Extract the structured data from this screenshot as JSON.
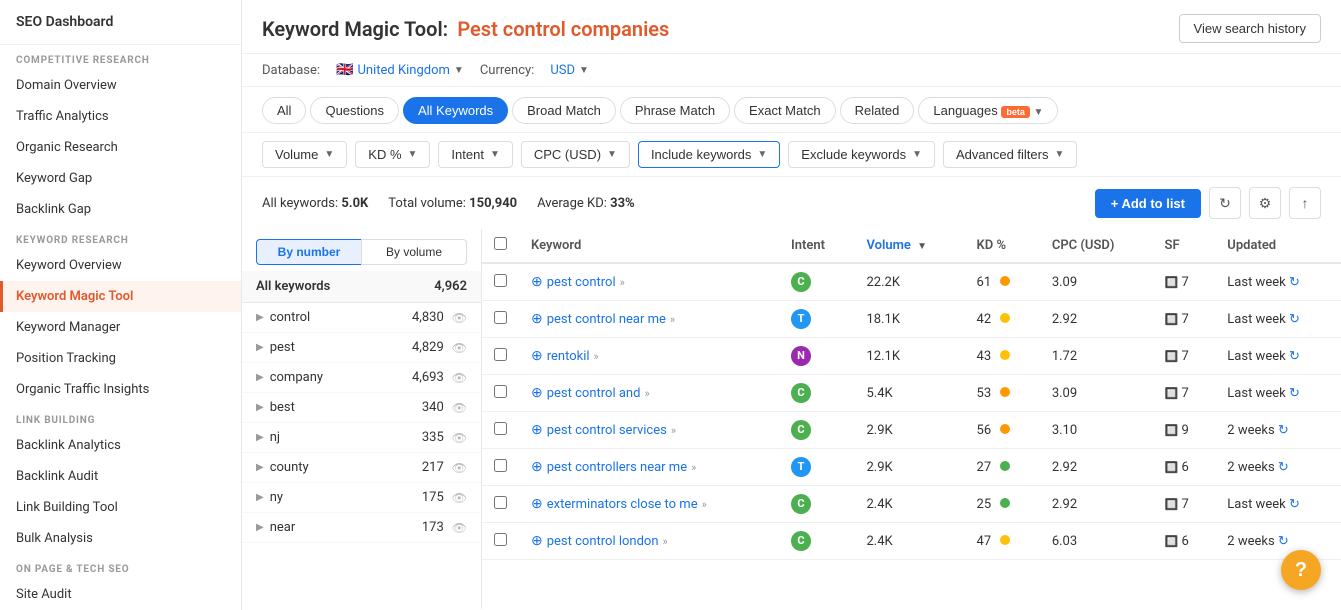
{
  "sidebar": {
    "logo": "SEO Dashboard",
    "sections": [
      {
        "label": "Competitive Research",
        "items": [
          {
            "id": "domain-overview",
            "label": "Domain Overview",
            "active": false
          },
          {
            "id": "traffic-analytics",
            "label": "Traffic Analytics",
            "active": false
          },
          {
            "id": "organic-research",
            "label": "Organic Research",
            "active": false
          },
          {
            "id": "keyword-gap",
            "label": "Keyword Gap",
            "active": false
          },
          {
            "id": "backlink-gap",
            "label": "Backlink Gap",
            "active": false
          }
        ]
      },
      {
        "label": "Keyword Research",
        "items": [
          {
            "id": "keyword-overview",
            "label": "Keyword Overview",
            "active": false
          },
          {
            "id": "keyword-magic-tool",
            "label": "Keyword Magic Tool",
            "active": true
          },
          {
            "id": "keyword-manager",
            "label": "Keyword Manager",
            "active": false
          },
          {
            "id": "position-tracking",
            "label": "Position Tracking",
            "active": false
          },
          {
            "id": "organic-traffic-insights",
            "label": "Organic Traffic Insights",
            "active": false
          }
        ]
      },
      {
        "label": "Link Building",
        "items": [
          {
            "id": "backlink-analytics",
            "label": "Backlink Analytics",
            "active": false
          },
          {
            "id": "backlink-audit",
            "label": "Backlink Audit",
            "active": false
          },
          {
            "id": "link-building-tool",
            "label": "Link Building Tool",
            "active": false
          },
          {
            "id": "bulk-analysis",
            "label": "Bulk Analysis",
            "active": false
          }
        ]
      },
      {
        "label": "On Page & Tech SEO",
        "items": [
          {
            "id": "site-audit",
            "label": "Site Audit",
            "active": false
          }
        ]
      }
    ]
  },
  "header": {
    "title_prefix": "Keyword Magic Tool:",
    "title_query": "Pest control companies",
    "view_history_label": "View search history",
    "database_label": "Database:",
    "database_country": "United Kingdom",
    "currency_label": "Currency:",
    "currency": "USD"
  },
  "tabs": {
    "items": [
      {
        "id": "all",
        "label": "All",
        "active": false
      },
      {
        "id": "questions",
        "label": "Questions",
        "active": false
      },
      {
        "id": "all-keywords",
        "label": "All Keywords",
        "active": true
      },
      {
        "id": "broad-match",
        "label": "Broad Match",
        "active": false
      },
      {
        "id": "phrase-match",
        "label": "Phrase Match",
        "active": false
      },
      {
        "id": "exact-match",
        "label": "Exact Match",
        "active": false
      },
      {
        "id": "related",
        "label": "Related",
        "active": false
      },
      {
        "id": "languages",
        "label": "Languages",
        "active": false,
        "beta": true
      }
    ]
  },
  "filters": {
    "items": [
      {
        "id": "volume",
        "label": "Volume",
        "has_dropdown": true
      },
      {
        "id": "kd",
        "label": "KD %",
        "has_dropdown": true
      },
      {
        "id": "intent",
        "label": "Intent",
        "has_dropdown": true
      },
      {
        "id": "cpc",
        "label": "CPC (USD)",
        "has_dropdown": true
      },
      {
        "id": "include-keywords",
        "label": "Include keywords",
        "has_dropdown": true,
        "highlighted": true
      },
      {
        "id": "exclude-keywords",
        "label": "Exclude keywords",
        "has_dropdown": true
      },
      {
        "id": "advanced-filters",
        "label": "Advanced filters",
        "has_dropdown": true
      }
    ]
  },
  "stats": {
    "all_keywords_label": "All keywords:",
    "all_keywords_value": "5.0K",
    "total_volume_label": "Total volume:",
    "total_volume_value": "150,940",
    "avg_kd_label": "Average KD:",
    "avg_kd_value": "33%",
    "add_to_list_label": "+ Add to list"
  },
  "left_panel": {
    "all_keywords_label": "All keywords",
    "all_keywords_count": "4,962",
    "by_number_label": "By number",
    "by_volume_label": "By volume",
    "items": [
      {
        "name": "control",
        "count": "4,830"
      },
      {
        "name": "pest",
        "count": "4,829"
      },
      {
        "name": "company",
        "count": "4,693"
      },
      {
        "name": "best",
        "count": "340"
      },
      {
        "name": "nj",
        "count": "335"
      },
      {
        "name": "county",
        "count": "217"
      },
      {
        "name": "ny",
        "count": "175"
      },
      {
        "name": "near",
        "count": "173"
      }
    ]
  },
  "table": {
    "columns": [
      {
        "id": "keyword",
        "label": "Keyword"
      },
      {
        "id": "intent",
        "label": "Intent"
      },
      {
        "id": "volume",
        "label": "Volume",
        "sorted": true
      },
      {
        "id": "kd",
        "label": "KD %"
      },
      {
        "id": "cpc",
        "label": "CPC (USD)"
      },
      {
        "id": "sf",
        "label": "SF"
      },
      {
        "id": "updated",
        "label": "Updated"
      }
    ],
    "rows": [
      {
        "keyword": "pest control",
        "intent": "C",
        "intent_type": "c",
        "volume": "22.2K",
        "kd": 61,
        "kd_dot": "orange",
        "cpc": "3.09",
        "sf": "7",
        "updated": "Last week"
      },
      {
        "keyword": "pest control near me",
        "intent": "T",
        "intent_type": "t",
        "volume": "18.1K",
        "kd": 42,
        "kd_dot": "yellow",
        "cpc": "2.92",
        "sf": "7",
        "updated": "Last week"
      },
      {
        "keyword": "rentokil",
        "intent": "N",
        "intent_type": "n",
        "volume": "12.1K",
        "kd": 43,
        "kd_dot": "yellow",
        "cpc": "1.72",
        "sf": "7",
        "updated": "Last week"
      },
      {
        "keyword": "pest control and",
        "intent": "C",
        "intent_type": "c",
        "volume": "5.4K",
        "kd": 53,
        "kd_dot": "orange",
        "cpc": "3.09",
        "sf": "7",
        "updated": "Last week"
      },
      {
        "keyword": "pest control services",
        "intent": "C",
        "intent_type": "c",
        "volume": "2.9K",
        "kd": 56,
        "kd_dot": "orange",
        "cpc": "3.10",
        "sf": "9",
        "updated": "2 weeks"
      },
      {
        "keyword": "pest controllers near me",
        "intent": "T",
        "intent_type": "t",
        "volume": "2.9K",
        "kd": 27,
        "kd_dot": "green",
        "cpc": "2.92",
        "sf": "6",
        "updated": "2 weeks"
      },
      {
        "keyword": "exterminators close to me",
        "intent": "C",
        "intent_type": "c",
        "volume": "2.4K",
        "kd": 25,
        "kd_dot": "green",
        "cpc": "2.92",
        "sf": "7",
        "updated": "Last week"
      },
      {
        "keyword": "pest control london",
        "intent": "C",
        "intent_type": "c",
        "volume": "2.4K",
        "kd": 47,
        "kd_dot": "yellow",
        "cpc": "6.03",
        "sf": "6",
        "updated": "2 weeks"
      }
    ]
  },
  "help_button": "?"
}
